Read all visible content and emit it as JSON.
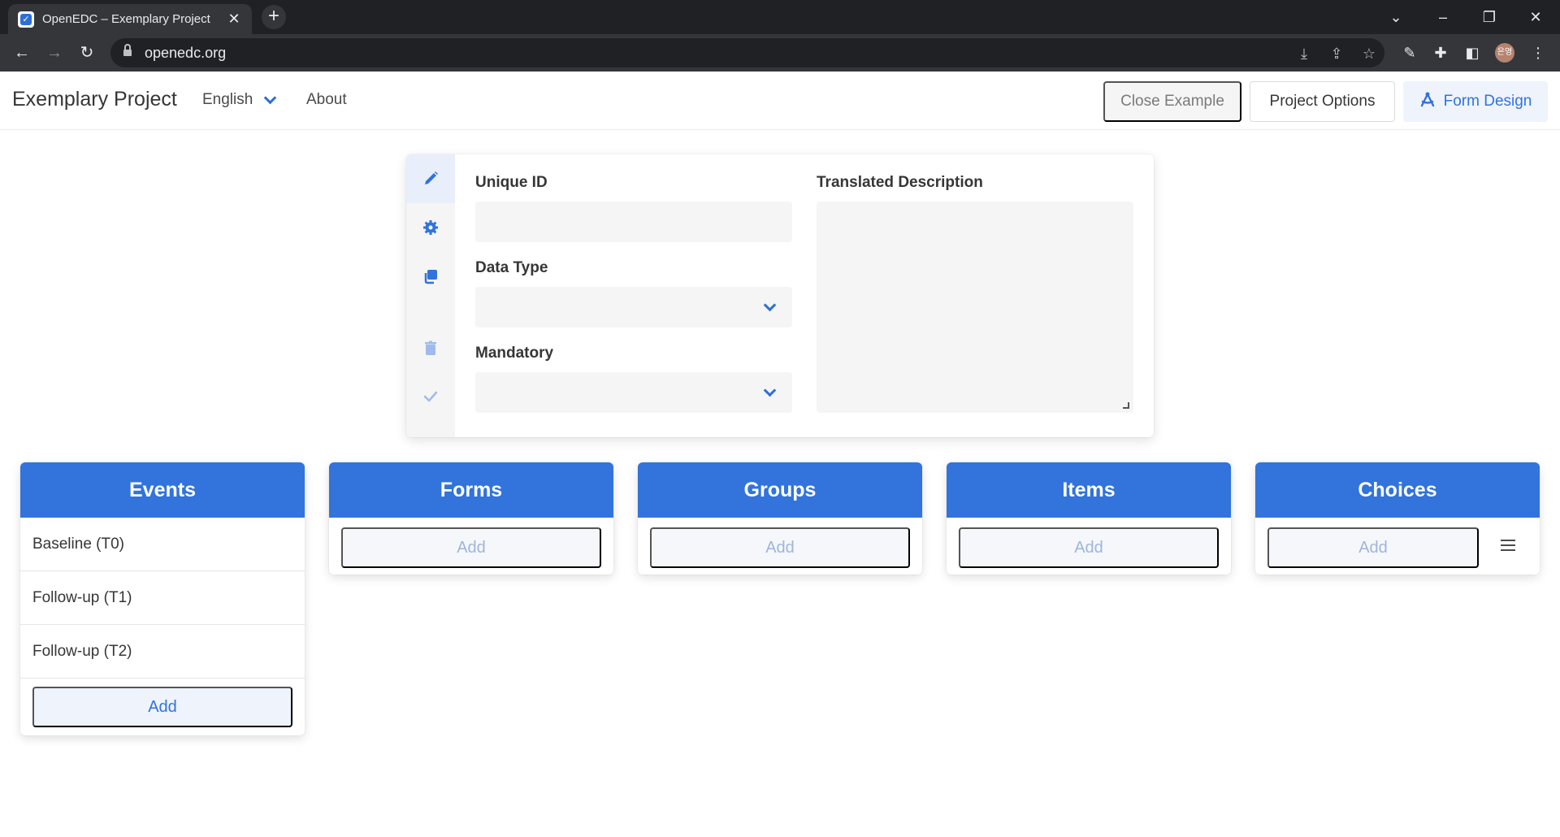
{
  "browser": {
    "tab_title": "OpenEDC – Exemplary Project",
    "url": "openedc.org",
    "avatar_text": "은영"
  },
  "header": {
    "brand": "Exemplary Project",
    "language": "English",
    "about": "About",
    "close_example": "Close Example",
    "project_options": "Project Options",
    "form_design": "Form Design"
  },
  "details": {
    "unique_id_label": "Unique ID",
    "unique_id_value": "",
    "data_type_label": "Data Type",
    "data_type_value": "",
    "mandatory_label": "Mandatory",
    "mandatory_value": "",
    "translated_description_label": "Translated Description",
    "translated_description_value": ""
  },
  "columns": {
    "events": {
      "title": "Events",
      "items": [
        "Baseline (T0)",
        "Follow-up (T1)",
        "Follow-up (T2)"
      ],
      "add_label": "Add"
    },
    "forms": {
      "title": "Forms",
      "add_label": "Add"
    },
    "groups": {
      "title": "Groups",
      "add_label": "Add"
    },
    "items": {
      "title": "Items",
      "add_label": "Add"
    },
    "choices": {
      "title": "Choices",
      "add_label": "Add"
    }
  },
  "colors": {
    "primary": "#3273dc",
    "chrome_dark": "#202124",
    "chrome_tab": "#35363a"
  }
}
